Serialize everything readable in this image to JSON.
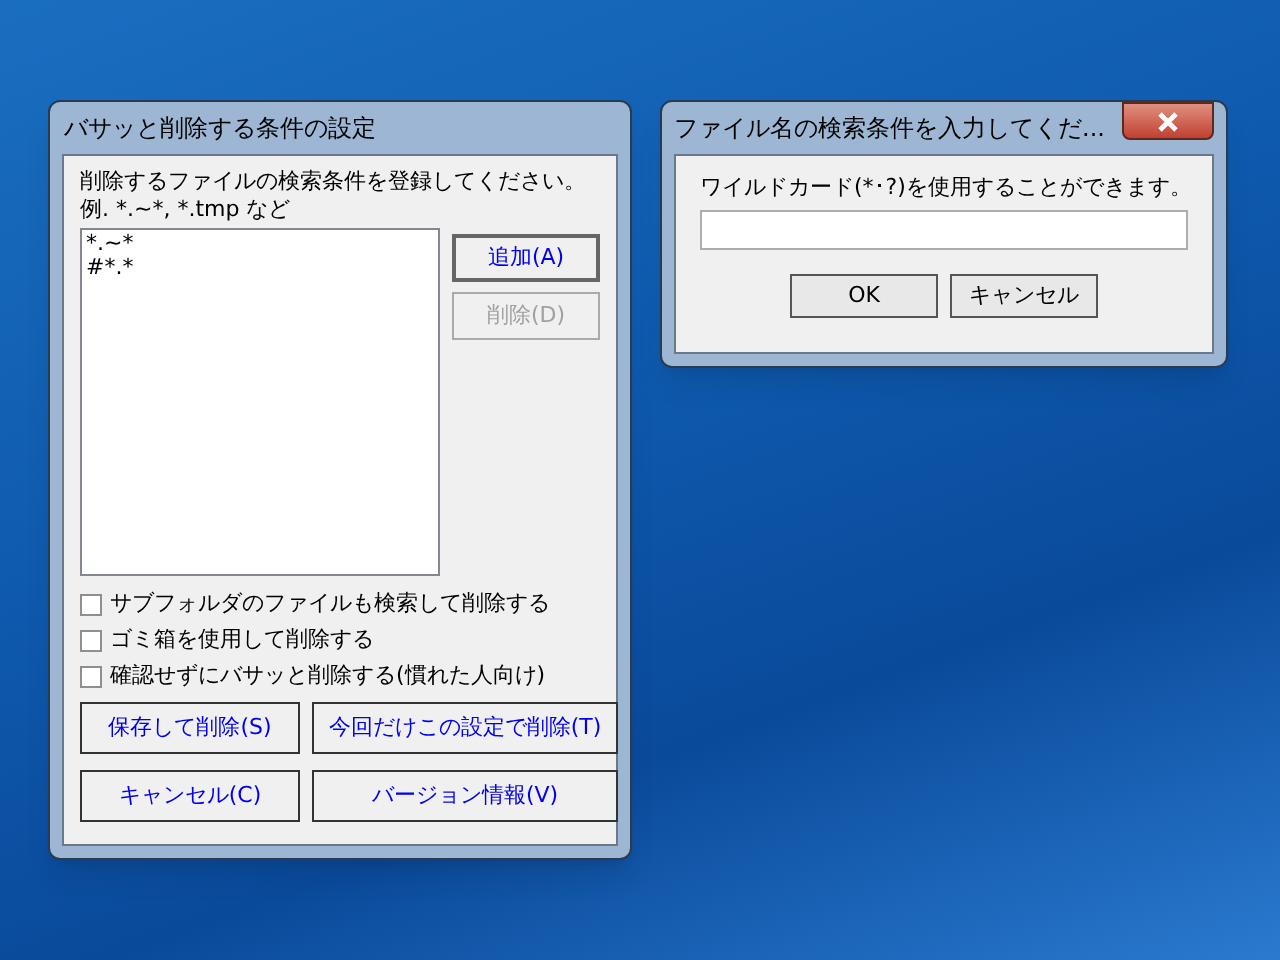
{
  "main_dialog": {
    "title": "バサッと削除する条件の設定",
    "instructions": "削除するファイルの検索条件を登録してください。",
    "example": "例. *.~*, *.tmp など",
    "patterns": [
      {
        "text": "*.~*"
      },
      {
        "text": "#*.*"
      }
    ],
    "side_buttons": [
      {
        "label": "追加(A)",
        "default": true,
        "disabled": false
      },
      {
        "label": "削除(D)",
        "default": false,
        "disabled": true
      }
    ],
    "options": [
      {
        "label": "サブフォルダのファイルも検索して削除する",
        "checked": false
      },
      {
        "label": "ゴミ箱を使用して削除する",
        "checked": false
      },
      {
        "label": "確認せずにバサッと削除する(慣れた人向け)",
        "checked": false
      }
    ],
    "buttons": [
      {
        "label": "保存して削除(S)"
      },
      {
        "label": "今回だけこの設定で削除(T)"
      },
      {
        "label": "キャンセル(C)"
      },
      {
        "label": "バージョン情報(V)"
      }
    ]
  },
  "input_dialog": {
    "title": "ファイル名の検索条件を入力してくだ...",
    "prompt": "ワイルドカード(*･?)を使用することができます。",
    "buttons": [
      {
        "label": "OK"
      },
      {
        "label": "キャンセル"
      }
    ]
  }
}
